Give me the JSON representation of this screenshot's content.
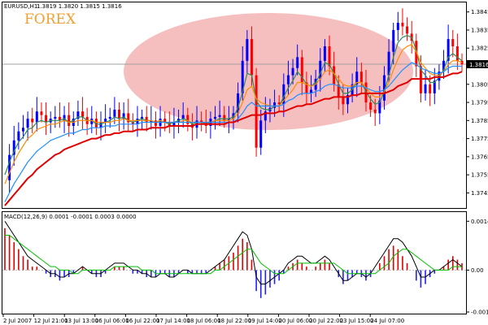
{
  "header": {
    "instrument": "EURUSD,H1",
    "ohlc": "1.3819 1.3820 1.3815 1.3816"
  },
  "overlay": {
    "brand": "FOREX",
    "ellipse_color": "#f4b4b4"
  },
  "colors": {
    "candle_up": "#0000ff",
    "candle_down": "#ff0000",
    "ma_fast": "#2e8b57",
    "ma_mid": "#ff8c00",
    "ma_slow": "#1e90ff",
    "ma_long": "#e00000",
    "macd_pos": "#e00000",
    "macd_neg": "#2020ff",
    "macd_signal": "#00c000",
    "macd_line": "#000000"
  },
  "chart_data": [
    {
      "type": "line",
      "panel": "price",
      "ylim": [
        1.3738,
        1.3848
      ],
      "y_ticks": [
        "1.3845",
        "1.3835",
        "1.3825",
        "1.3816",
        "1.3805",
        "1.3795",
        "1.3785",
        "1.3775",
        "1.3765",
        "1.3755",
        "1.3745"
      ],
      "current_price": "1.3816",
      "x_ticks": [
        "2 Jul 2007",
        "12 Jul 21:00",
        "13 Jul 13:00",
        "16 Jul 06:00",
        "16 Jul 22:00",
        "17 Jul 14:00",
        "18 Jul 06:00",
        "18 Jul 22:00",
        "19 Jul 14:00",
        "20 Jul 06:00",
        "20 Jul 22:00",
        "23 Jul 15:00",
        "24 Jul 07:00"
      ],
      "close": [
        1.3752,
        1.3766,
        1.3774,
        1.3779,
        1.3781,
        1.3786,
        1.3784,
        1.379,
        1.3788,
        1.3784,
        1.3786,
        1.3787,
        1.3785,
        1.3788,
        1.3782,
        1.3786,
        1.379,
        1.3787,
        1.3783,
        1.3786,
        1.3781,
        1.3784,
        1.3786,
        1.3787,
        1.3791,
        1.3786,
        1.3789,
        1.3784,
        1.3783,
        1.3786,
        1.3787,
        1.3784,
        1.3785,
        1.3782,
        1.3786,
        1.3784,
        1.3782,
        1.3784,
        1.3786,
        1.3788,
        1.3783,
        1.3781,
        1.3785,
        1.3784,
        1.3782,
        1.3786,
        1.3787,
        1.3788,
        1.3785,
        1.3786,
        1.3789,
        1.38,
        1.3818,
        1.383,
        1.381,
        1.377,
        1.3785,
        1.379,
        1.3792,
        1.3795,
        1.3794,
        1.3805,
        1.381,
        1.3814,
        1.382,
        1.3806,
        1.38,
        1.3802,
        1.3808,
        1.3818,
        1.3826,
        1.3815,
        1.3805,
        1.3798,
        1.3794,
        1.3799,
        1.3805,
        1.3812,
        1.3806,
        1.3795,
        1.3791,
        1.3789,
        1.3796,
        1.381,
        1.3823,
        1.3835,
        1.3839,
        1.3837,
        1.3833,
        1.3829,
        1.3815,
        1.38,
        1.3805,
        1.38,
        1.3807,
        1.3812,
        1.3818,
        1.383,
        1.3826,
        1.3818,
        1.3816
      ],
      "series": [
        {
          "name": "MA fast",
          "values": [
            1.3755,
            1.3762,
            1.3768,
            1.3773,
            1.3776,
            1.378,
            1.3781,
            1.3784,
            1.3785,
            1.3784,
            1.3785,
            1.3785,
            1.3785,
            1.3786,
            1.3784,
            1.3785,
            1.3787,
            1.3787,
            1.3785,
            1.3785,
            1.3783,
            1.3783,
            1.3784,
            1.3785,
            1.3787,
            1.3786,
            1.3787,
            1.3785,
            1.3784,
            1.3785,
            1.3786,
            1.3785,
            1.3785,
            1.3784,
            1.3785,
            1.3784,
            1.3783,
            1.3784,
            1.3785,
            1.3786,
            1.3785,
            1.3783,
            1.3784,
            1.3784,
            1.3783,
            1.3784,
            1.3785,
            1.3786,
            1.3786,
            1.3786,
            1.3787,
            1.3792,
            1.3801,
            1.3811,
            1.381,
            1.3796,
            1.3792,
            1.3791,
            1.3791,
            1.3793,
            1.3793,
            1.3798,
            1.3803,
            1.3807,
            1.3812,
            1.3809,
            1.3805,
            1.3804,
            1.3806,
            1.3811,
            1.3817,
            1.3816,
            1.3811,
            1.3805,
            1.38,
            1.38,
            1.3802,
            1.3806,
            1.3806,
            1.3801,
            1.3797,
            1.3794,
            1.3795,
            1.3801,
            1.381,
            1.382,
            1.3828,
            1.3831,
            1.3832,
            1.3831,
            1.3824,
            1.3813,
            1.381,
            1.3806,
            1.3806,
            1.3809,
            1.3813,
            1.382,
            1.3822,
            1.382,
            1.3818
          ]
        },
        {
          "name": "MA mid",
          "values": [
            1.375,
            1.3756,
            1.3762,
            1.3767,
            1.3771,
            1.3775,
            1.3777,
            1.378,
            1.3781,
            1.3782,
            1.3783,
            1.3783,
            1.3784,
            1.3785,
            1.3784,
            1.3784,
            1.3785,
            1.3785,
            1.3785,
            1.3785,
            1.3784,
            1.3784,
            1.3784,
            1.3784,
            1.3785,
            1.3785,
            1.3786,
            1.3785,
            1.3785,
            1.3785,
            1.3785,
            1.3785,
            1.3785,
            1.3784,
            1.3785,
            1.3784,
            1.3784,
            1.3784,
            1.3784,
            1.3785,
            1.3785,
            1.3784,
            1.3784,
            1.3784,
            1.3784,
            1.3784,
            1.3785,
            1.3785,
            1.3785,
            1.3785,
            1.3786,
            1.3789,
            1.3795,
            1.3802,
            1.3804,
            1.3797,
            1.3795,
            1.3794,
            1.3793,
            1.3793,
            1.3793,
            1.3796,
            1.3799,
            1.3802,
            1.3806,
            1.3806,
            1.3805,
            1.3804,
            1.3805,
            1.3808,
            1.3812,
            1.3813,
            1.3811,
            1.3808,
            1.3805,
            1.3804,
            1.3804,
            1.3806,
            1.3806,
            1.3803,
            1.38,
            1.3798,
            1.3798,
            1.3801,
            1.3806,
            1.3813,
            1.3819,
            1.3824,
            1.3826,
            1.3827,
            1.3823,
            1.3817,
            1.3814,
            1.3811,
            1.381,
            1.381,
            1.3812,
            1.3816,
            1.3818,
            1.3818,
            1.3817
          ]
        },
        {
          "name": "MA slow",
          "values": [
            1.374,
            1.3745,
            1.375,
            1.3754,
            1.3758,
            1.3762,
            1.3765,
            1.3768,
            1.377,
            1.3772,
            1.3774,
            1.3775,
            1.3776,
            1.3777,
            1.3778,
            1.3778,
            1.3779,
            1.378,
            1.378,
            1.3781,
            1.3781,
            1.3781,
            1.3782,
            1.3782,
            1.3782,
            1.3783,
            1.3783,
            1.3783,
            1.3783,
            1.3783,
            1.3784,
            1.3784,
            1.3784,
            1.3784,
            1.3784,
            1.3784,
            1.3784,
            1.3784,
            1.3784,
            1.3784,
            1.3784,
            1.3784,
            1.3784,
            1.3784,
            1.3784,
            1.3784,
            1.3784,
            1.3784,
            1.3784,
            1.3784,
            1.3784,
            1.3786,
            1.3789,
            1.3793,
            1.3795,
            1.3793,
            1.3793,
            1.3793,
            1.3793,
            1.3793,
            1.3793,
            1.3794,
            1.3796,
            1.3797,
            1.3799,
            1.38,
            1.38,
            1.38,
            1.3801,
            1.3802,
            1.3804,
            1.3805,
            1.3805,
            1.3804,
            1.3803,
            1.3803,
            1.3803,
            1.3804,
            1.3804,
            1.3803,
            1.3802,
            1.3801,
            1.3801,
            1.3802,
            1.3804,
            1.3807,
            1.381,
            1.3813,
            1.3815,
            1.3817,
            1.3816,
            1.3814,
            1.3813,
            1.3812,
            1.3811,
            1.3811,
            1.3812,
            1.3814,
            1.3815,
            1.3815,
            1.3815
          ]
        },
        {
          "name": "MA long",
          "values": [
            1.3738,
            1.3741,
            1.3744,
            1.3747,
            1.375,
            1.3753,
            1.3755,
            1.3758,
            1.376,
            1.3762,
            1.3764,
            1.3766,
            1.3767,
            1.3769,
            1.377,
            1.3771,
            1.3772,
            1.3773,
            1.3774,
            1.3775,
            1.3775,
            1.3776,
            1.3777,
            1.3777,
            1.3778,
            1.3778,
            1.3779,
            1.3779,
            1.3779,
            1.378,
            1.378,
            1.378,
            1.3781,
            1.3781,
            1.3781,
            1.3781,
            1.3782,
            1.3782,
            1.3782,
            1.3782,
            1.3782,
            1.3782,
            1.3783,
            1.3783,
            1.3783,
            1.3783,
            1.3783,
            1.3783,
            1.3783,
            1.3784,
            1.3784,
            1.3785,
            1.3786,
            1.3787,
            1.3788,
            1.3788,
            1.3788,
            1.3789,
            1.3789,
            1.3789,
            1.379,
            1.379,
            1.3791,
            1.3792,
            1.3793,
            1.3793,
            1.3794,
            1.3794,
            1.3795,
            1.3796,
            1.3797,
            1.3797,
            1.3798,
            1.3798,
            1.3798,
            1.3798,
            1.3799,
            1.3799,
            1.38,
            1.38,
            1.38,
            1.38,
            1.38,
            1.38,
            1.3801,
            1.3802,
            1.3804,
            1.3805,
            1.3806,
            1.3808,
            1.3808,
            1.3808,
            1.3808,
            1.3808,
            1.3809,
            1.3809,
            1.3809,
            1.381,
            1.3811,
            1.3811,
            1.3812
          ]
        }
      ]
    },
    {
      "type": "bar",
      "panel": "macd",
      "title": "MACD(12,26,9) 0.0001 -0.0001 0.0003 0.0000",
      "ylim": [
        -0.0012,
        0.0015
      ],
      "y_ticks": [
        "0.0014",
        "0.00",
        "-0.0012"
      ],
      "histogram": [
        0.0012,
        0.001,
        0.0008,
        0.0006,
        0.0004,
        0.0003,
        0.0001,
        0.0001,
        0.0,
        -0.0001,
        -0.0002,
        -0.0002,
        -0.0003,
        -0.0002,
        -0.0002,
        -0.0001,
        0.0,
        0.0001,
        0.0,
        -0.0001,
        -0.0002,
        -0.0002,
        -0.0001,
        0.0,
        0.0001,
        0.0001,
        0.0001,
        0.0,
        -0.0001,
        -0.0001,
        -0.0001,
        -0.0002,
        -0.0002,
        -0.0002,
        -0.0001,
        -0.0001,
        -0.0002,
        -0.0002,
        -0.0001,
        0.0,
        -0.0001,
        -0.0001,
        -0.0001,
        -0.0001,
        -0.0001,
        0.0,
        0.0001,
        0.0002,
        0.0003,
        0.0004,
        0.0005,
        0.0007,
        0.0009,
        0.0008,
        0.0003,
        -0.0006,
        -0.0008,
        -0.0007,
        -0.0005,
        -0.0004,
        -0.0003,
        -0.0001,
        0.0001,
        0.0002,
        0.0003,
        0.0002,
        0.0001,
        0.0,
        0.0001,
        0.0002,
        0.0003,
        0.0002,
        0.0,
        -0.0002,
        -0.0004,
        -0.0003,
        -0.0002,
        -0.0001,
        -0.0002,
        -0.0003,
        -0.0002,
        0.0,
        0.0002,
        0.0004,
        0.0006,
        0.0007,
        0.0006,
        0.0004,
        0.0002,
        0.0,
        -0.0003,
        -0.0005,
        -0.0004,
        -0.0002,
        -0.0001,
        0.0,
        0.0001,
        0.0003,
        0.0004,
        0.0003,
        0.0002
      ],
      "series": [
        {
          "name": "Main",
          "values": [
            0.0014,
            0.0012,
            0.001,
            0.0008,
            0.0006,
            0.0004,
            0.0003,
            0.0002,
            0.0001,
            0.0,
            -0.0001,
            -0.0001,
            -0.0002,
            -0.0002,
            -0.0001,
            -0.0001,
            0.0,
            0.0001,
            0.0,
            -0.0001,
            -0.0001,
            -0.0001,
            0.0,
            0.0001,
            0.0002,
            0.0002,
            0.0002,
            0.0001,
            0.0,
            0.0,
            -0.0001,
            -0.0001,
            -0.0002,
            -0.0002,
            -0.0001,
            -0.0001,
            -0.0002,
            -0.0002,
            -0.0001,
            0.0,
            0.0,
            -0.0001,
            -0.0001,
            -0.0001,
            -0.0001,
            0.0,
            0.0001,
            0.0002,
            0.0003,
            0.0005,
            0.0007,
            0.0009,
            0.0011,
            0.001,
            0.0006,
            -0.0002,
            -0.0004,
            -0.0004,
            -0.0003,
            -0.0002,
            -0.0001,
            0.0,
            0.0002,
            0.0003,
            0.0004,
            0.0004,
            0.0003,
            0.0002,
            0.0002,
            0.0003,
            0.0004,
            0.0003,
            0.0001,
            -0.0001,
            -0.0003,
            -0.0003,
            -0.0002,
            -0.0001,
            -0.0001,
            -0.0002,
            -0.0001,
            0.0001,
            0.0003,
            0.0005,
            0.0007,
            0.0009,
            0.0009,
            0.0008,
            0.0006,
            0.0004,
            0.0001,
            -0.0002,
            -0.0002,
            -0.0001,
            0.0,
            0.0,
            0.0001,
            0.0002,
            0.0003,
            0.0002,
            0.0001
          ]
        },
        {
          "name": "Signal",
          "values": [
            0.001,
            0.001,
            0.0009,
            0.0008,
            0.0007,
            0.0006,
            0.0005,
            0.0004,
            0.0003,
            0.0002,
            0.0001,
            0.0001,
            0.0,
            0.0,
            0.0,
            -0.0001,
            -0.0001,
            0.0,
            0.0,
            0.0,
            0.0,
            0.0,
            0.0,
            0.0,
            0.0001,
            0.0001,
            0.0001,
            0.0001,
            0.0001,
            0.0001,
            0.0,
            0.0,
            0.0,
            -0.0001,
            -0.0001,
            -0.0001,
            -0.0001,
            -0.0001,
            -0.0001,
            -0.0001,
            -0.0001,
            -0.0001,
            -0.0001,
            -0.0001,
            -0.0001,
            -0.0001,
            0.0,
            0.0,
            0.0001,
            0.0002,
            0.0003,
            0.0004,
            0.0005,
            0.0006,
            0.0006,
            0.0004,
            0.0002,
            0.0001,
            0.0,
            -0.0001,
            -0.0001,
            -0.0001,
            0.0,
            0.0001,
            0.0002,
            0.0002,
            0.0002,
            0.0002,
            0.0002,
            0.0002,
            0.0002,
            0.0002,
            0.0002,
            0.0001,
            0.0,
            -0.0001,
            -0.0001,
            -0.0001,
            -0.0001,
            -0.0001,
            -0.0001,
            -0.0001,
            0.0,
            0.0001,
            0.0002,
            0.0004,
            0.0005,
            0.0006,
            0.0006,
            0.0005,
            0.0004,
            0.0003,
            0.0002,
            0.0001,
            0.0,
            0.0,
            0.0,
            0.0,
            0.0001,
            0.0001,
            0.0001
          ]
        }
      ]
    }
  ]
}
